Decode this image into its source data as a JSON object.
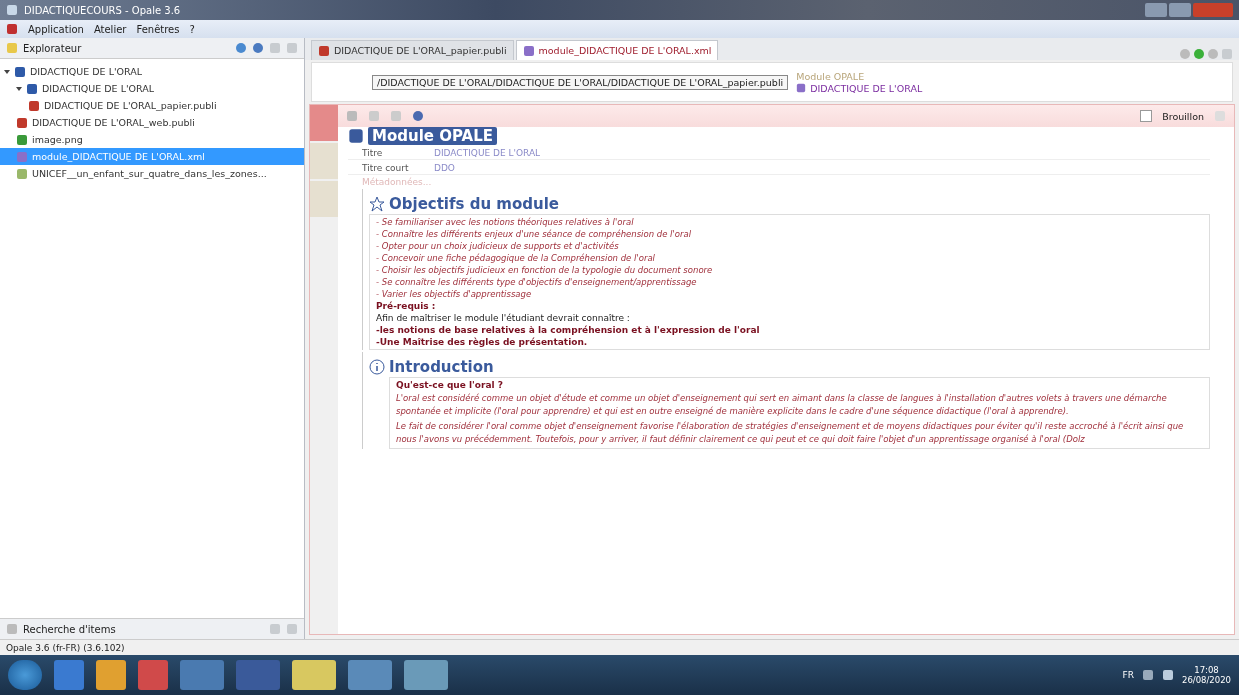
{
  "window": {
    "title": "DIDACTIQUECOURS - Opale 3.6"
  },
  "menu": [
    "Application",
    "Atelier",
    "Fenêtres",
    "?"
  ],
  "explorer": {
    "title": "Explorateur",
    "tree": [
      {
        "label": "DIDACTIQUE DE L'ORAL",
        "kind": "folder",
        "expanded": true,
        "selected": false,
        "children": [
          {
            "label": "DIDACTIQUE DE L'ORAL",
            "kind": "folder",
            "expanded": true,
            "selected": false,
            "children": [
              {
                "label": "DIDACTIQUE DE L'ORAL_papier.publi",
                "kind": "publication",
                "selected": false
              }
            ]
          },
          {
            "label": "DIDACTIQUE DE L'ORAL_web.publi",
            "kind": "publication",
            "selected": false
          },
          {
            "label": "image.png",
            "kind": "image",
            "selected": false
          },
          {
            "label": "module_DIDACTIQUE DE L'ORAL.xml",
            "kind": "module",
            "selected": true
          },
          {
            "label": "UNICEF__un_enfant_sur_quatre_dans_les_zones...",
            "kind": "file",
            "selected": false
          }
        ]
      }
    ]
  },
  "search_panel": {
    "title": "Recherche d'items"
  },
  "editor": {
    "tabs": [
      {
        "label": "DIDACTIQUE DE L'ORAL_papier.publi",
        "kind": "publication",
        "selected": false
      },
      {
        "label": "module_DIDACTIQUE DE L'ORAL.xml",
        "kind": "module",
        "selected": true
      }
    ],
    "breadcrumb": {
      "type_label": "Module OPALE",
      "item": "DIDACTIQUE DE L'ORAL",
      "tooltip": "/DIDACTIQUE DE L'ORAL/DIDACTIQUE DE L'ORAL/DIDACTIQUE DE L'ORAL_papier.publi"
    },
    "draft": {
      "label": "Brouillon",
      "checked": false
    },
    "side_tabs": [
      {
        "selected": true
      },
      {
        "selected": false
      },
      {
        "selected": false
      }
    ],
    "module": {
      "title": "Module OPALE",
      "fields": [
        {
          "label": "Titre",
          "value": "DIDACTIQUE DE L'ORAL"
        },
        {
          "label": "Titre court",
          "value": "DDO"
        }
      ],
      "metadata": "Métadonnées..."
    },
    "objectives": {
      "heading": "Objectifs du module",
      "items": [
        "- Se familiariser avec les notions théoriques relatives à l'oral",
        "- Connaître les différents enjeux d'une séance de compréhension de l'oral",
        "- Opter pour un choix judicieux de supports et d'activités",
        "- Concevoir une fiche pédagogique de la Compréhension de l'oral",
        "- Choisir les objectifs judicieux en fonction de la typologie du document sonore",
        "- Se connaître les différents type d'objectifs d'enseignement/apprentissage",
        "- Varier les objectifs d'apprentissage"
      ],
      "prereq_label": "Pré-requis :",
      "prereq_intro": "Afin de maîtriser le module l'étudiant devrait connaître :",
      "prereq_items": [
        "-les notions de base relatives à la compréhension et à l'expression de l'oral",
        "-Une Maîtrise des règles de présentation."
      ]
    },
    "introduction": {
      "heading": "Introduction",
      "question": "Qu'est-ce que l'oral ?",
      "paragraphs": [
        "L'oral est considéré comme un objet d'étude et comme un objet d'enseignement qui sert en aimant dans la classe de langues à l'installation d'autres volets à travers une démarche spontanée et implicite (l'oral pour apprendre) et qui est en outre enseigné de manière explicite dans le cadre d'une séquence didactique (l'oral à apprendre).",
        "Le fait de considérer l'oral comme objet d'enseignement favorise l'élaboration de stratégies d'enseignement et de moyens didactiques pour éviter qu'il reste accroché à l'écrit ainsi que nous l'avons vu précédemment. Toutefois, pour y arriver, il faut définir clairement ce qui peut et ce qui doit faire l'objet d'un apprentissage organisé à l'oral (Dolz"
      ]
    }
  },
  "status_bar": "Opale 3.6 (fr-FR) (3.6.102)",
  "taskbar": {
    "language": "FR",
    "time": "17:08",
    "date": "26/08/2020"
  }
}
